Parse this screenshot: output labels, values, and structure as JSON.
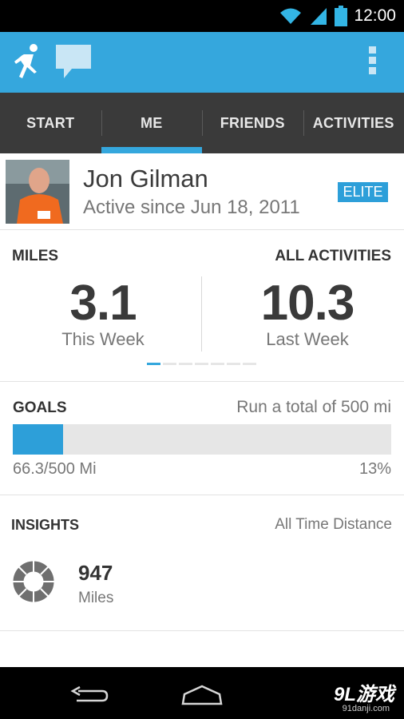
{
  "status_bar": {
    "time": "12:00",
    "icons": [
      "wifi-icon",
      "signal-icon",
      "battery-icon"
    ]
  },
  "app_bar": {
    "icons": [
      "runner-icon",
      "chat-icon",
      "overflow-menu-icon"
    ],
    "color": "#35a7dd"
  },
  "tabs": [
    {
      "label": "START",
      "active": false
    },
    {
      "label": "ME",
      "active": true
    },
    {
      "label": "FRIENDS",
      "active": false
    },
    {
      "label": "ACTIVITIES",
      "active": false
    }
  ],
  "profile": {
    "name": "Jon Gilman",
    "active_since": "Active since Jun 18, 2011",
    "badge": "ELITE"
  },
  "stats": {
    "left_label": "MILES",
    "right_label": "ALL ACTIVITIES",
    "this_week_value": "3.1",
    "this_week_label": "This Week",
    "last_week_value": "10.3",
    "last_week_label": "Last Week",
    "pager_count": 7,
    "pager_active_index": 0
  },
  "goals": {
    "title": "GOALS",
    "description": "Run a total of 500 mi",
    "progress_text": "66.3/500 Mi",
    "percent_text": "13%",
    "progress_fraction": 0.133
  },
  "insights": {
    "title": "INSIGHTS",
    "filter": "All Time Distance",
    "value": "947",
    "unit": "Miles"
  },
  "nav_bar": {
    "icons": [
      "back-icon",
      "home-icon"
    ],
    "watermark": "9L游戏",
    "watermark_sub": "91danji.com"
  },
  "colors": {
    "accent": "#35a7dd",
    "tab_bg": "#3a3a3a",
    "badge": "#2d9fd9"
  }
}
